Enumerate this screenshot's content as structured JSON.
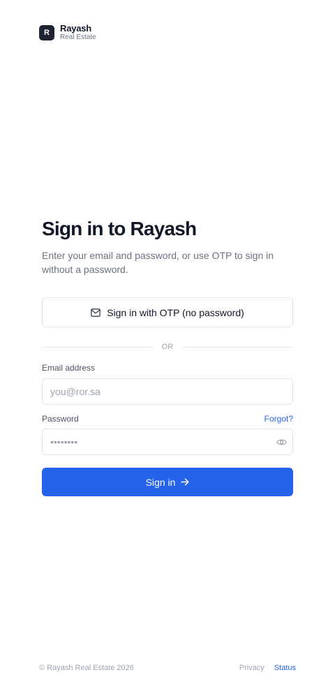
{
  "brand": {
    "logo_letter": "R",
    "name": "Rayash",
    "subtitle": "Real Estate"
  },
  "signin": {
    "title": "Sign in to Rayash",
    "subtitle": "Enter your email and password, or use OTP to sign in without a password.",
    "otp_button_label": "Sign in with OTP (no password)",
    "divider_text": "OR",
    "email": {
      "label": "Email address",
      "placeholder": "you@ror.sa",
      "value": ""
    },
    "password": {
      "label": "Password",
      "placeholder": "••••••••",
      "value": "",
      "forgot_label": "Forgot?"
    },
    "submit_label": "Sign in"
  },
  "footer": {
    "copyright": "© Rayash Real Estate 2026",
    "links": {
      "privacy": "Privacy",
      "status": "Status"
    }
  },
  "colors": {
    "accent": "#2563eb",
    "logo_bg": "#1e2433",
    "text_primary": "#111827",
    "text_muted": "#6b7280",
    "border": "#e2e5ea"
  },
  "icons": {
    "otp_button": "mail-icon",
    "password_toggle": "eye-icon",
    "submit": "arrow-right-icon"
  }
}
